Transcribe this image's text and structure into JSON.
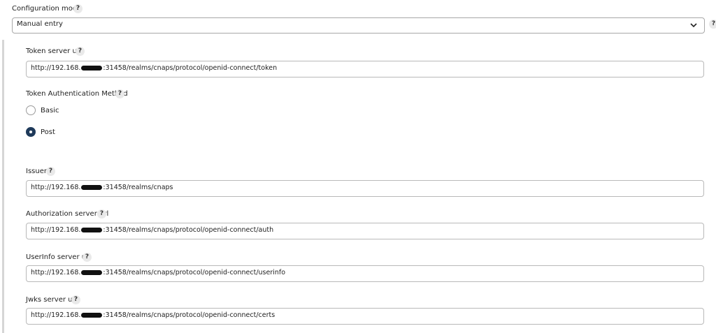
{
  "config_mode": {
    "label": "Configuration mode",
    "help": "?",
    "selected": "Manual entry",
    "outer_help": "?"
  },
  "token_server": {
    "label": "Token server url",
    "help": "?",
    "value_prefix": "http://192.168.",
    "value_suffix": ":31458/realms/cnaps/protocol/openid-connect/token"
  },
  "token_auth": {
    "label": "Token Authentication Method",
    "help": "?",
    "options": [
      {
        "label": "Basic",
        "checked": false
      },
      {
        "label": "Post",
        "checked": true
      }
    ]
  },
  "issuer": {
    "label": "Issuer",
    "help": "?",
    "value_prefix": "http://192.168.",
    "value_suffix": ":31458/realms/cnaps"
  },
  "authorization_server": {
    "label": "Authorization server url",
    "help": "?",
    "value_prefix": "http://192.168.",
    "value_suffix": ":31458/realms/cnaps/protocol/openid-connect/auth"
  },
  "userinfo_server": {
    "label": "UserInfo server url",
    "help": "?",
    "value_prefix": "http://192.168.",
    "value_suffix": ":31458/realms/cnaps/protocol/openid-connect/userinfo"
  },
  "jwks_server": {
    "label": "Jwks server url",
    "help": "?",
    "value_prefix": "http://192.168.",
    "value_suffix": ":31458/realms/cnaps/protocol/openid-connect/certs"
  }
}
